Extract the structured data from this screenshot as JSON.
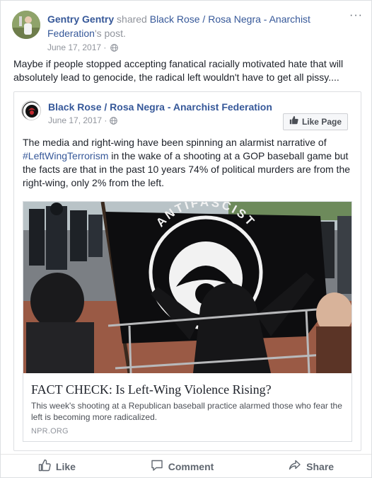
{
  "post": {
    "author": "Gentry Gentry",
    "shared_verb": "shared",
    "shared_page": "Black Rose / Rosa Negra - Anarchist Federation",
    "shared_suffix": "'s post.",
    "date": "June 17, 2017",
    "more_label": "···",
    "text": "Maybe if people stopped accepting fanatical racially motivated hate that will absolutely lead to genocide, the radical left wouldn't have to get all pissy...."
  },
  "shared_post": {
    "page_name": "Black Rose / Rosa Negra - Anarchist Federation",
    "date": "June 17, 2017",
    "like_page_label": "Like Page",
    "text_before": "The media and right-wing have been spinning an alarmist narrative of ",
    "hashtag": "#LeftWingTerrorism",
    "text_after": " in the wake of a shooting at a GOP baseball game but the facts are that in the past 10 years 74% of political murders are from the right-wing, only 2% from the left."
  },
  "link_preview": {
    "image_text": "ANTIFASCIST",
    "title": "FACT CHECK: Is Left-Wing Violence Rising?",
    "description": "This week's shooting at a Republican baseball practice alarmed those who fear the left is becoming more radicalized.",
    "domain": "NPR.ORG"
  },
  "actions": {
    "like": "Like",
    "comment": "Comment",
    "share": "Share"
  },
  "icons": {
    "privacy": "globe-icon",
    "like": "thumbs-up-icon",
    "comment": "speech-bubble-icon",
    "share": "share-arrow-icon"
  },
  "colors": {
    "link": "#365899",
    "meta": "#90949c",
    "action": "#606770"
  }
}
